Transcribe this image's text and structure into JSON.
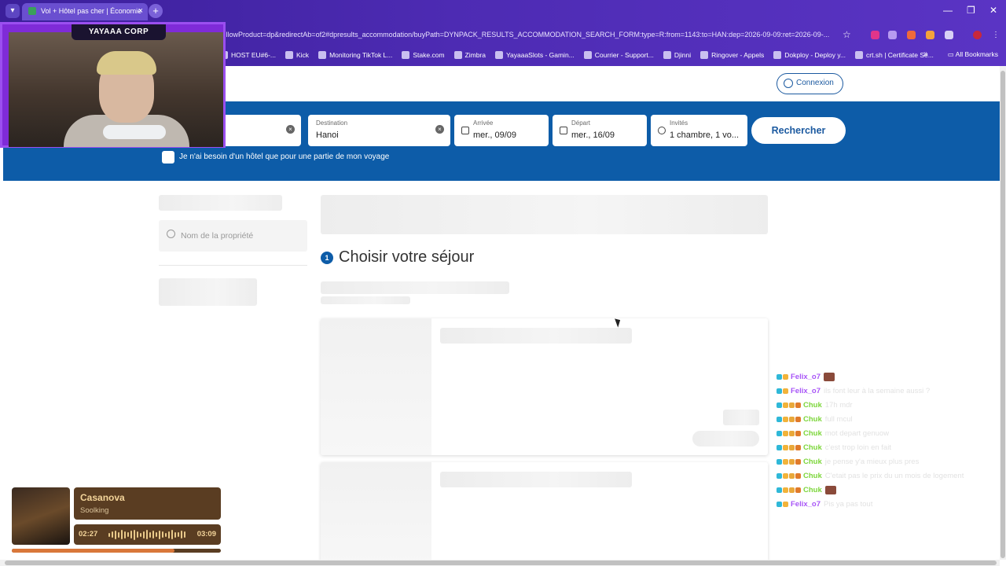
{
  "browser": {
    "tab_title": "Vol + Hôtel pas cher | Économie",
    "url": "...llowProduct=dp&redirectAb=of2#dpresults_accommodation/buyPath=DYNPACK_RESULTS_ACCOMMODATION_SEARCH_FORM:type=R:from=1143:to=HAN:dep=2026-09-09:ret=2026-09-...",
    "bookmarks": [
      "HOST EU#6-...",
      "Kick",
      "Monitoring TikTok L...",
      "Stake.com",
      "Zimbra",
      "YayaaaSlots - Gamin...",
      "Courrier - Support...",
      "Djinni",
      "Ringover - Appels",
      "Dokploy - Deploy y...",
      "crt.sh | Certificate Se..."
    ],
    "all_bookmarks": "All Bookmarks"
  },
  "webcam": {
    "label": "YAYAAA CORP"
  },
  "header": {
    "login_label": "Connexion"
  },
  "search": {
    "destination_label": "Destination",
    "destination_value": "Hanoi",
    "arrival_label": "Arrivée",
    "arrival_value": "mer., 09/09",
    "departure_label": "Départ",
    "departure_value": "mer., 16/09",
    "guests_label": "Invités",
    "guests_value": "1 chambre, 1 vo...",
    "submit_label": "Rechercher",
    "partial_stay_label": "Je n'ai besoin d'un hôtel que pour une partie de mon voyage"
  },
  "sidebar": {
    "property_search_placeholder": "Nom de la propriété"
  },
  "main": {
    "step_number": "1",
    "step_title": "Choisir votre séjour"
  },
  "chat": [
    {
      "user": "Felix_o7",
      "color": "#a855f7",
      "msg": "",
      "emote": true
    },
    {
      "user": "Felix_o7",
      "color": "#a855f7",
      "msg": "ils font leur à la semaine aussi ?"
    },
    {
      "user": "Chuk",
      "color": "#7cd63a",
      "msg": "17h mdr"
    },
    {
      "user": "Chuk",
      "color": "#7cd63a",
      "msg": "full mcul"
    },
    {
      "user": "Chuk",
      "color": "#7cd63a",
      "msg": "mot depart genuow"
    },
    {
      "user": "Chuk",
      "color": "#7cd63a",
      "msg": "c'est trop loin en fait"
    },
    {
      "user": "Chuk",
      "color": "#7cd63a",
      "msg": "je pense y'a mieux plus pres"
    },
    {
      "user": "Chuk",
      "color": "#7cd63a",
      "msg": "C'etait pas le prix du un mois de logement"
    },
    {
      "user": "Chuk",
      "color": "#7cd63a",
      "msg": "",
      "emote": true
    },
    {
      "user": "Felix_o7",
      "color": "#a855f7",
      "msg": "Pis ya pas tout"
    }
  ],
  "music": {
    "title": "Casanova",
    "artist": "Soolking",
    "current_time": "02:27",
    "total_time": "03:09",
    "progress": 0.78,
    "colors": {
      "panel": "#5a3d22",
      "accent": "#d9773a"
    }
  }
}
